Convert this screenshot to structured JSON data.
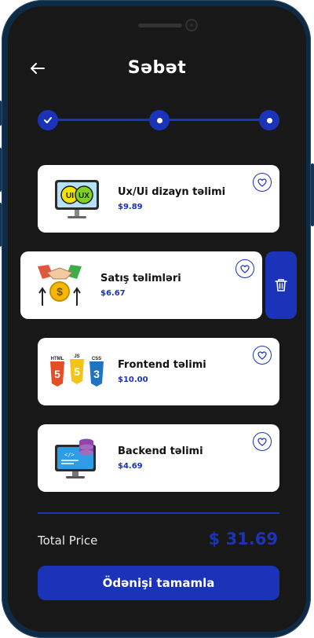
{
  "header": {
    "back_icon": "arrow-left-icon",
    "title": "Səbət"
  },
  "stepper": {
    "steps": [
      {
        "state": "done",
        "icon": "check-icon"
      },
      {
        "state": "pending"
      },
      {
        "state": "pending"
      }
    ],
    "accent": "#1a33b8"
  },
  "cart": {
    "items": [
      {
        "title": "Ux/Ui dizayn təlimi",
        "price": "$9.89",
        "icon": "ui-ux-monitor-icon"
      },
      {
        "title": "Satış təlimləri",
        "price": "$6.67",
        "icon": "sales-handshake-icon"
      },
      {
        "title": "Frontend təlimi",
        "price": "$10.00",
        "icon": "html-js-css-icon",
        "tags": [
          "HTML",
          "JS",
          "CSS"
        ]
      },
      {
        "title": "Backend təlimi",
        "price": "$4.69",
        "icon": "backend-monitor-icon"
      }
    ],
    "swiped_item_action_icon": "trash-icon"
  },
  "summary": {
    "total_label": "Total Price",
    "total_value": "$ 31.69"
  },
  "checkout": {
    "label": "Ödənişi tamamla"
  },
  "colors": {
    "background": "#181818",
    "card": "#ffffff",
    "accent": "#1a33b8"
  }
}
